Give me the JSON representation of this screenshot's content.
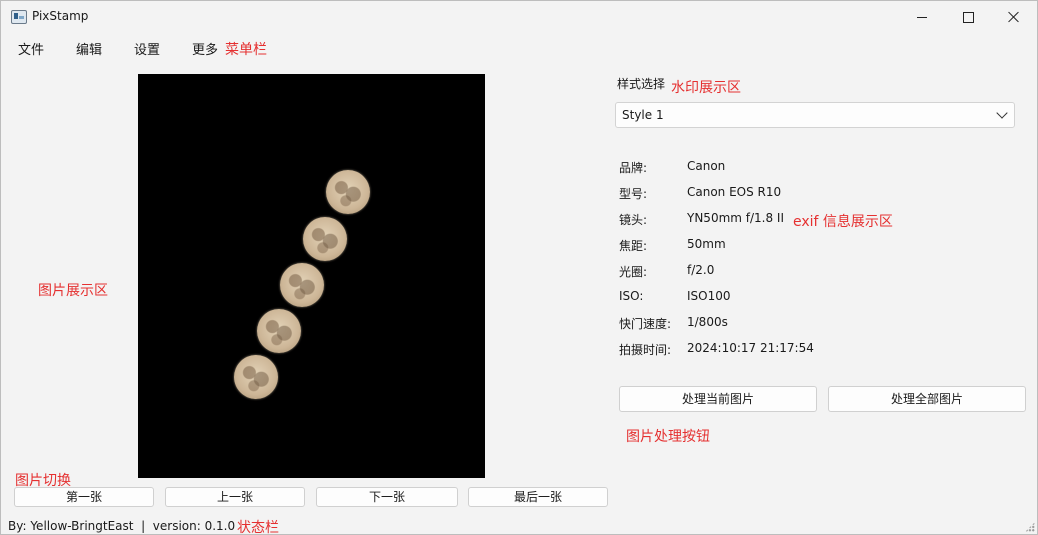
{
  "window": {
    "title": "PixStamp"
  },
  "menu": {
    "items": [
      "文件",
      "编辑",
      "设置",
      "更多"
    ]
  },
  "annotations": {
    "menu_bar": "菜单栏",
    "watermark_area": "水印展示区",
    "image_area": "图片展示区",
    "exif_area": "exif 信息展示区",
    "process_buttons": "图片处理按钮",
    "image_switch": "图片切换",
    "status_bar": "状态栏"
  },
  "style_select": {
    "label": "样式选择",
    "value": "Style 1"
  },
  "exif": [
    {
      "label": "品牌:",
      "value": "Canon"
    },
    {
      "label": "型号:",
      "value": "Canon EOS R10"
    },
    {
      "label": "镜头:",
      "value": "YN50mm f/1.8 II"
    },
    {
      "label": "焦距:",
      "value": "50mm"
    },
    {
      "label": "光圈:",
      "value": "f/2.0"
    },
    {
      "label": "ISO:",
      "value": "ISO100"
    },
    {
      "label": "快门速度:",
      "value": "1/800s"
    },
    {
      "label": "拍摄时间:",
      "value": "2024:10:17 21:17:54"
    }
  ],
  "process": {
    "current": "处理当前图片",
    "all": "处理全部图片"
  },
  "nav": {
    "first": "第一张",
    "prev": "上一张",
    "next": "下一张",
    "last": "最后一张"
  },
  "status": {
    "text": "By: Yellow-BringtEast  |  version: 0.1.0"
  },
  "colors": {
    "annotation": "#e53030",
    "photo_bg": "#000000",
    "window_bg": "#f3f3f3"
  }
}
